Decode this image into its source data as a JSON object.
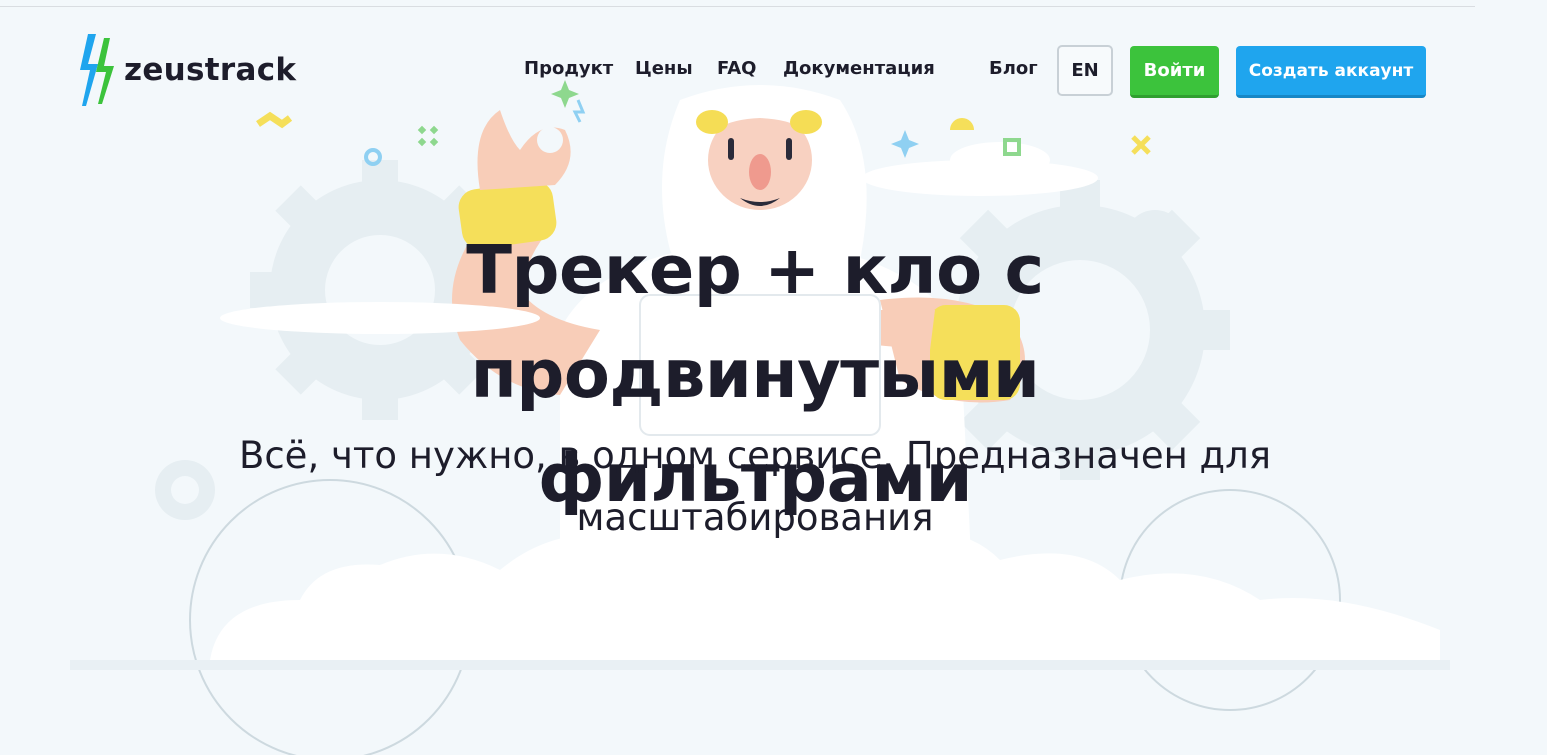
{
  "brand": {
    "name": "zeustrack",
    "colors": {
      "bolt_blue": "#1fa5ee",
      "bolt_green": "#3cc33c"
    }
  },
  "nav": {
    "items": [
      {
        "label": "Продукт"
      },
      {
        "label": "Цены"
      },
      {
        "label": "FAQ"
      },
      {
        "label": "Документация"
      },
      {
        "label": "Блог"
      }
    ],
    "language": "EN",
    "login": "Войти",
    "signup": "Создать аккаунт"
  },
  "hero": {
    "title_line1": "Трекер + кло с продвинутыми",
    "title_line2": "фильтрами",
    "subtitle_line1": "Всё, что нужно, в одном сервисе. Предназначен для",
    "subtitle_line2": "масштабирования",
    "illustration": "zeus-character-illustration"
  },
  "colors": {
    "background": "#f3f8fb",
    "text": "#1d1d2b",
    "login_button": "#3cc33c",
    "signup_button": "#1fa5ee"
  }
}
